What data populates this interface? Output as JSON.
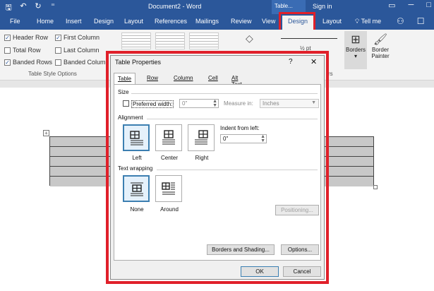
{
  "titlebar": {
    "doc_title": "Document2 - Word",
    "context_tab": "Table...",
    "sign_in": "Sign in"
  },
  "tabs": [
    "File",
    "Home",
    "Insert",
    "Design",
    "Layout",
    "References",
    "Mailings",
    "Review",
    "View",
    "Design",
    "Layout"
  ],
  "tell_me": "Tell me",
  "ribbon": {
    "options": {
      "header_row": "Header Row",
      "first_column": "First Column",
      "total_row": "Total Row",
      "last_column": "Last Column",
      "banded_rows": "Banded Rows",
      "banded_columns": "Banded Column"
    },
    "group_label": "Table Style Options",
    "pen_weight": "½ pt",
    "borders_label": "Borders",
    "painter_label_1": "Border",
    "painter_label_2": "Painter",
    "borders_group_tail": "rs"
  },
  "dialog": {
    "title": "Table Properties",
    "help": "?",
    "close": "✕",
    "tabs": [
      "Table",
      "Row",
      "Column",
      "Cell",
      "Alt Text"
    ],
    "size": {
      "heading": "Size",
      "preferred_width_label": "Preferred width:",
      "preferred_width_value": "0\"",
      "measure_in_label": "Measure in:",
      "measure_in_value": "Inches"
    },
    "alignment": {
      "heading": "Alignment",
      "options": [
        "Left",
        "Center",
        "Right"
      ],
      "indent_label": "Indent from left:",
      "indent_value": "0\""
    },
    "text_wrapping": {
      "heading": "Text wrapping",
      "options": [
        "None",
        "Around"
      ],
      "positioning_button": "Positioning..."
    },
    "borders_button": "Borders and Shading...",
    "options_button": "Options...",
    "ok_button": "OK",
    "cancel_button": "Cancel"
  }
}
